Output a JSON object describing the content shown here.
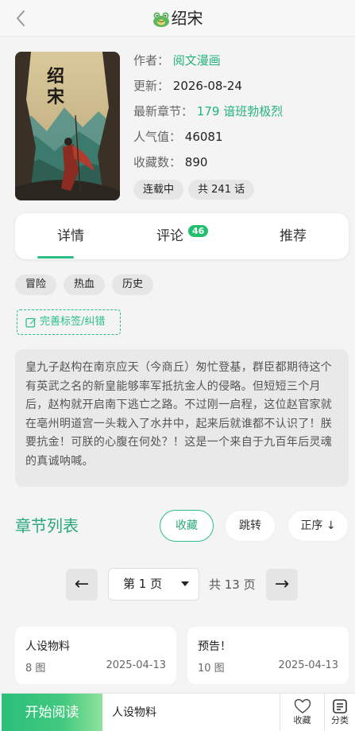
{
  "header": {
    "title": "绍宋"
  },
  "book": {
    "cover_title": "绍宋",
    "author_label": "作者：",
    "author": "阅文漫画",
    "updated_label": "更新：",
    "updated": "2026-08-24",
    "latest_label": "最新章节：",
    "latest": "179 谙班勃极烈",
    "popularity_label": "人气值：",
    "popularity": "46081",
    "favorites_label": "收藏数：",
    "favorites": "890",
    "status": "连载中",
    "total_chapters": "共 241 话"
  },
  "tabs": [
    {
      "label": "详情",
      "active": true
    },
    {
      "label": "评论",
      "badge": "46"
    },
    {
      "label": "推荐"
    }
  ],
  "genres": [
    "冒险",
    "热血",
    "历史"
  ],
  "edit_tags_label": "完善标签/纠错",
  "synopsis": "皇九子赵构在南京应天（今商丘）匆忙登基，群臣都期待这个有英武之名的新皇能够率军抵抗金人的侵略。但短短三个月后，赵构就开启南下逃亡之路。不过刚一启程，这位赵官家就在亳州明道宫一头栽入了水井中，起来后就谁都不认识了！朕要抗金！可朕的心腹在何处？！这是一个来自于九百年后灵魂的真诚呐喊。",
  "chapter_list": {
    "title": "章节列表",
    "favorite_button": "收藏",
    "jump_button": "跳转",
    "order_button": "正序 ↓",
    "pagination": {
      "prev": "←",
      "next": "→",
      "current_page": "第 1 页",
      "total_pages": "共 13 页"
    },
    "chapters": [
      {
        "name": "人设物料",
        "count": "8 图",
        "date": "2025-04-13"
      },
      {
        "name": "预告！",
        "count": "10 图",
        "date": "2025-04-13"
      }
    ]
  },
  "bottom_bar": {
    "start_reading": "开始阅读",
    "current_chapter": "人设物料",
    "favorite_label": "收藏",
    "catalog_label": "分类"
  },
  "colors": {
    "accent": "#2abf86",
    "badge": "#22c06e"
  }
}
